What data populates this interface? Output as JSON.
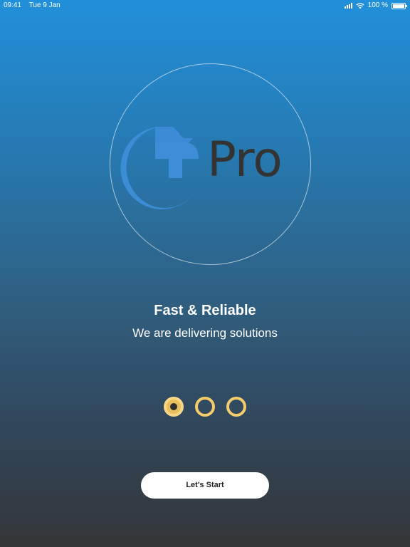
{
  "status_bar": {
    "time": "09:41",
    "date": "Tue 9 Jan",
    "battery": "100 %"
  },
  "logo": {
    "wordmark": "Pro",
    "mark_letter": "T",
    "colors": {
      "mark": "#3c8ed8",
      "wordmark": "#333333"
    }
  },
  "onboarding": {
    "title": "Fast & Reliable",
    "subtitle": "We are delivering solutions",
    "pages_total": 3,
    "current_page": 1
  },
  "actions": {
    "start_label": "Let's Start"
  },
  "colors": {
    "indicator": "#f4cc6c",
    "gradient_top": "#2190da",
    "gradient_bottom": "#343638"
  }
}
